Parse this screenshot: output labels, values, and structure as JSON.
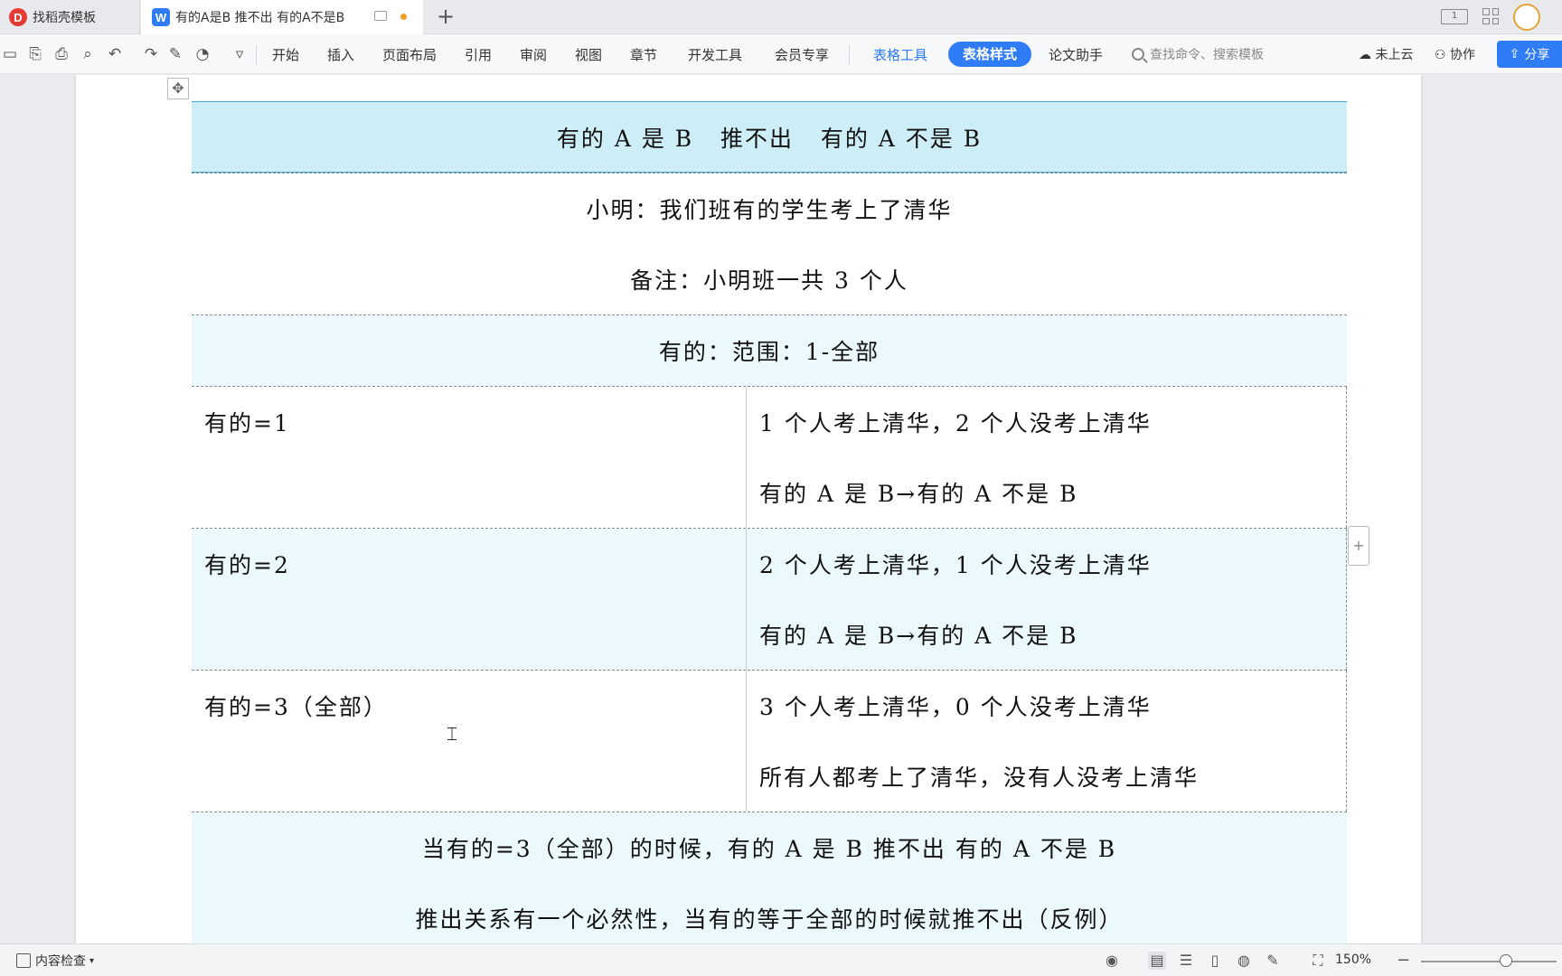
{
  "tabs": [
    {
      "title": "找稻壳模板",
      "active": false
    },
    {
      "title": "有的A是B 推不出 有的A不是B",
      "active": true
    }
  ],
  "new_tab_label": "+",
  "toolbar": {
    "menus": [
      "开始",
      "插入",
      "页面布局",
      "引用",
      "审阅",
      "视图",
      "章节",
      "开发工具",
      "会员专享"
    ],
    "context_menus": {
      "table_tools": "表格工具",
      "table_style": "表格样式",
      "thesis_helper": "论文助手"
    },
    "search_placeholder": "查找命令、搜索模板",
    "cloud_status": "未上云",
    "collaborate": "协作",
    "share": "分享",
    "accent_color": "#2f7cf6"
  },
  "table": {
    "title": "有的 A 是 B   推不出   有的 A 不是 B",
    "intro": [
      "小明：我们班有的学生考上了清华",
      "备注：小明班一共 3 个人"
    ],
    "range": "有的：范围：1-全部",
    "cases": [
      {
        "left": "有的=1",
        "right": [
          "1 个人考上清华，2 个人没考上清华",
          "有的 A 是 B→有的 A 不是 B"
        ]
      },
      {
        "left": "有的=2",
        "right": [
          "2 个人考上清华，1 个人没考上清华",
          "有的 A 是 B→有的 A 不是 B"
        ]
      },
      {
        "left": "有的=3（全部）",
        "right": [
          "3 个人考上清华，0 个人没考上清华",
          "所有人都考上了清华，没有人没考上清华"
        ]
      }
    ],
    "conclusion": [
      "当有的=3（全部）的时候，有的 A 是 B  推不出  有的 A 不是 B",
      "推出关系有一个必然性，当有的等于全部的时候就推不出（反例）"
    ],
    "header_color": "#cdeef6",
    "alt_row_color": "#ebf8fc"
  },
  "statusbar": {
    "content_check": "内容检查",
    "zoom": "150%"
  }
}
